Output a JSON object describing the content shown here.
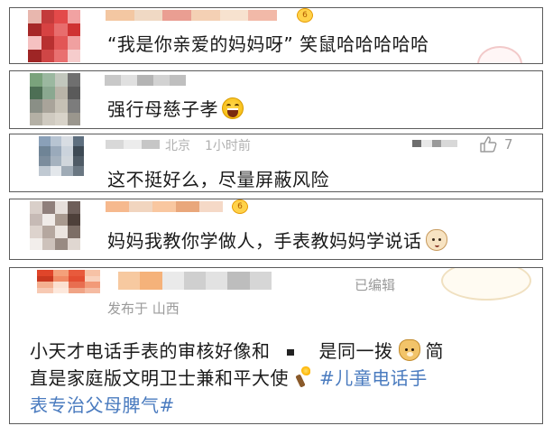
{
  "comments": [
    {
      "text": "“我是你亲爱的妈妈呀” 笑鼠哈哈哈哈哈",
      "badge": "6",
      "avatar_colors": [
        "#e8b7ae",
        "#c33b3b",
        "#e34a4a",
        "#f1a2a2",
        "#a62828",
        "#d74242",
        "#e86d6d",
        "#cf3333",
        "#f5c1c1",
        "#b83030",
        "#e25656",
        "#f0a0a0",
        "#9e2525",
        "#cf4646",
        "#e97070",
        "#f6cccc"
      ],
      "name_colors": [
        "#f3c7a2",
        "#f0d9c4",
        "#ea9e92",
        "#f4d0b4",
        "#f7e2cf",
        "#f2b9a8"
      ]
    },
    {
      "text": "强行母慈子孝",
      "emoji": "laugh-emoji",
      "avatar_colors": [
        "#7aa37c",
        "#9bb8a0",
        "#c2c7bd",
        "#6f6f6f",
        "#4d6f55",
        "#8aa890",
        "#b9b4a8",
        "#5a5a5a",
        "#8a8f86",
        "#a9a49a",
        "#c6c1b5",
        "#7c7c7c",
        "#b4b0a5",
        "#cfcac0",
        "#d8d3c9",
        "#9a968d"
      ],
      "name_colors": [
        "#c8c8c8",
        "#e0e0e0",
        "#b4b4b4",
        "#d2d2d2",
        "#bfbfbf"
      ]
    },
    {
      "location": "北京",
      "time": "1小时前",
      "text": "这不挺好么，尽量屏蔽风险",
      "likes": "7",
      "avatar_colors": [
        "#8aa0b8",
        "#b7c4d2",
        "#d8dde3",
        "#5e6f7f",
        "#6f8496",
        "#9aaabb",
        "#cbd3dc",
        "#3e4a55",
        "#7c8d9d",
        "#a5b2bf",
        "#d0d6dc",
        "#4f5b66",
        "#c0c9d2",
        "#e3e7eb",
        "#9fabb6",
        "#6a7782"
      ],
      "name_colors": [
        "#d8d8d8",
        "#ececec",
        "#c6c6c6"
      ]
    },
    {
      "text": "妈妈我教你学做人，手表教妈妈学说话",
      "emoji": "cat-emoji",
      "badge": "6",
      "avatar_colors": [
        "#d9cfc9",
        "#8f7f7b",
        "#e6dfdb",
        "#6e5f5a",
        "#c6bab5",
        "#f0ebe8",
        "#a8998f",
        "#4e403a",
        "#ddd3cd",
        "#b5a79f",
        "#ebe4df",
        "#7d6e66",
        "#f2eeeb",
        "#cdc2bb",
        "#988a82",
        "#e0d7d1"
      ],
      "name_colors": [
        "#f6b98e",
        "#f1d5bf",
        "#f9c7a0",
        "#e9a77b",
        "#f5d9c7"
      ]
    },
    {
      "location": "发布于 山西",
      "edited": "已编辑",
      "text_line1_a": "小天才电话手表的审核好像和",
      "text_line1_b": "是同一拨",
      "text_line1_c": "简",
      "text_line2": "直是家庭版文明卫士兼和平大使",
      "hashtag_part1": "#儿童电话手",
      "text_line3": "表专治父母脾气#",
      "avatar_colors": [
        "#e0452a",
        "#f4a07a",
        "#e85a3c",
        "#f7c2a6",
        "#c93820",
        "#f08a64",
        "#e34e32",
        "#f9d2bd",
        "#f4b090",
        "#fbe0d0",
        "#e86e50",
        "#f29a78",
        "#f7c9b3",
        "#fde8dc",
        "#f0a486",
        "#f5bba2"
      ],
      "name_colors": [
        "#f7c9a0",
        "#f5b27a",
        "#eaeaea",
        "#cfcfcf",
        "#e2e2e2",
        "#bdbdbd",
        "#d6d6d6"
      ]
    }
  ]
}
